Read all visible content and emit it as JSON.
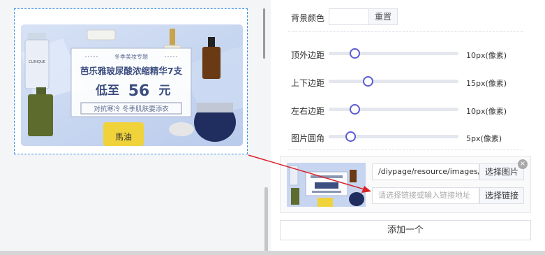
{
  "banner": {
    "tag": "冬季美妆专题",
    "title": "芭乐雅玻尿酸浓缩精华7支",
    "price_prefix": "低至",
    "price": "56",
    "price_unit": "元",
    "subtitle": "对抗寒冷 冬季肌肤要添衣",
    "product_clinique": "CLINIQUE",
    "product_mayou": "馬油"
  },
  "settings": {
    "bg_color_label": "背景颜色",
    "reset_label": "重置",
    "rows": [
      {
        "label": "顶外边距",
        "value_text": "10px(像素)",
        "value": 10
      },
      {
        "label": "上下边距",
        "value_text": "15px(像素)",
        "value": 15
      },
      {
        "label": "左右边距",
        "value_text": "10px(像素)",
        "value": 10
      },
      {
        "label": "图片圆角",
        "value_text": "5px(像素)",
        "value": 5
      }
    ]
  },
  "item": {
    "image_path": "/diypage/resource/images/di",
    "choose_image": "选择图片",
    "link_placeholder": "请选择链接或输入链接地址",
    "choose_link": "选择链接",
    "close_glyph": "×"
  },
  "add_label": "添加一个",
  "colors": {
    "accent": "#5b5bd6",
    "selection": "#3a8ee6",
    "arrow": "#d9232b"
  }
}
